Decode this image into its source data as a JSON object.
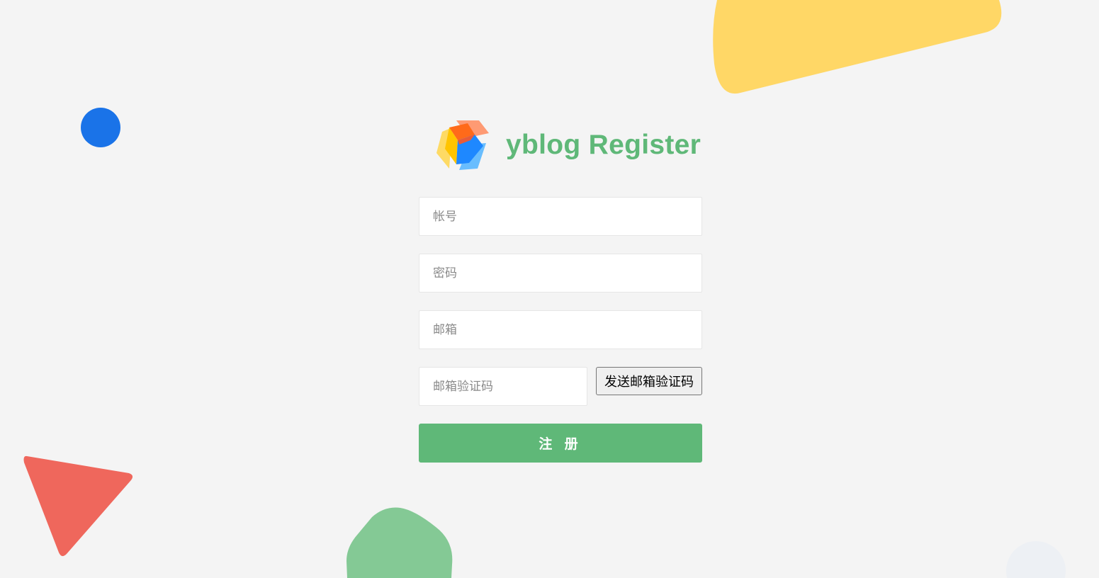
{
  "page": {
    "title": "yblog Register",
    "logo_icon": "cube-logo-icon",
    "brand_color": "#5fb878"
  },
  "form": {
    "account_placeholder": "帐号",
    "password_placeholder": "密码",
    "email_placeholder": "邮箱",
    "email_code_placeholder": "邮箱验证码",
    "send_code_label": "发送邮箱验证码",
    "submit_label": "注 册"
  },
  "decorations": {
    "yellow_shape_color": "#ffd766",
    "blue_circle_color": "#1a73e8",
    "red_triangle_color": "#ef675c",
    "green_blob_color": "#84c995",
    "faint_circle_color": "#edf0f4"
  }
}
